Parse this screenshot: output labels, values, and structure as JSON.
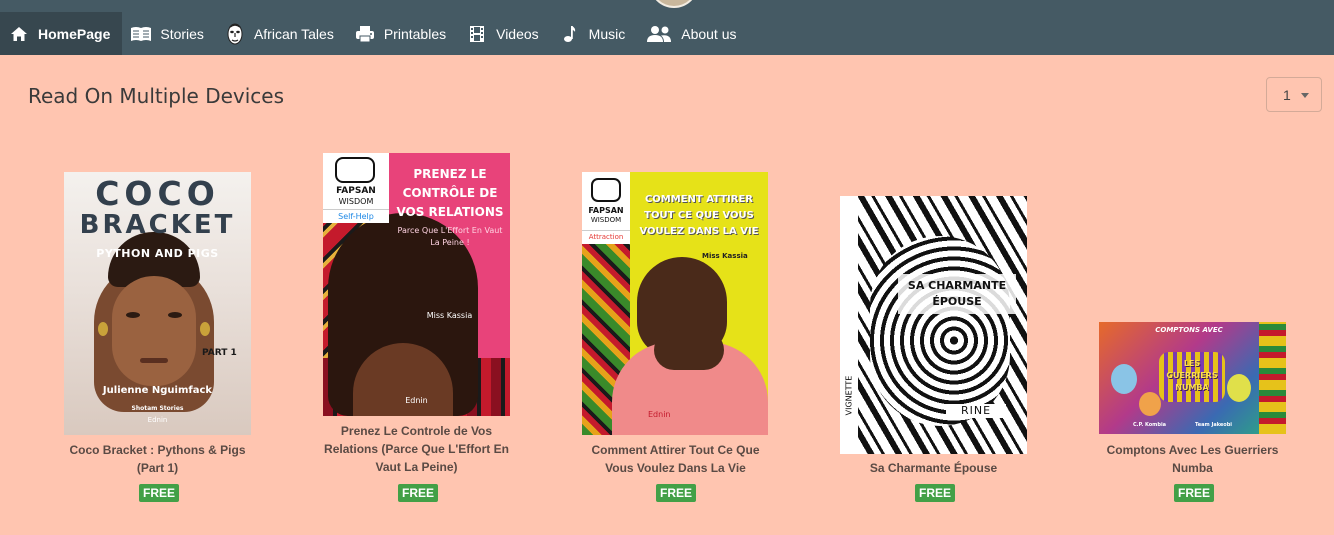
{
  "nav": {
    "items": [
      {
        "label": "HomePage",
        "icon": "home-icon"
      },
      {
        "label": "Stories",
        "icon": "book-icon"
      },
      {
        "label": "African Tales",
        "icon": "mask-icon"
      },
      {
        "label": "Printables",
        "icon": "printer-icon"
      },
      {
        "label": "Videos",
        "icon": "film-icon"
      },
      {
        "label": "Music",
        "icon": "music-note-icon"
      },
      {
        "label": "About us",
        "icon": "users-icon"
      }
    ]
  },
  "section": {
    "title": "Read On Multiple Devices",
    "page_select_value": "1"
  },
  "books": [
    {
      "title": "Coco Bracket : Pythons & Pigs (Part 1)",
      "price": "FREE",
      "cover": {
        "line1": "COCO",
        "line2": "BRACKET",
        "line3": "PYTHON AND PIGS",
        "part": "PART 1",
        "author": "Julienne Nguimfack",
        "publisher": "Shotam Stories",
        "imprint": "Ednin"
      }
    },
    {
      "title": "Prenez Le Controle de Vos Relations (Parce Que L'Effort En Vaut La Peine)",
      "price": "FREE",
      "cover": {
        "brand1": "FAPSAN",
        "brand2": "WISDOM",
        "category": "Self-Help",
        "headline": "PRENEZ LE CONTRÔLE DE VOS RELATIONS",
        "subtitle": "Parce Que L'Effort En Vaut La Peine !",
        "author": "Miss Kassia",
        "imprint": "Ednin"
      }
    },
    {
      "title": "Comment Attirer Tout Ce Que Vous Voulez Dans La Vie",
      "price": "FREE",
      "cover": {
        "brand1": "FAPSAN",
        "brand2": "WISDOM",
        "category": "Attraction",
        "headline": "COMMENT ATTIRER TOUT CE QUE VOUS VOULEZ DANS LA VIE",
        "author": "Miss Kassia",
        "imprint": "Ednin"
      }
    },
    {
      "title": "Sa Charmante Épouse",
      "price": "FREE",
      "cover": {
        "headline": "SA CHARMANTE ÉPOUSE",
        "series": "VIGNETTE",
        "author": "RINE"
      }
    },
    {
      "title": "Comptons Avec Les Guerriers Numba",
      "price": "FREE",
      "cover": {
        "headline1": "COMPTONS AVEC",
        "headline2": "LES GUERRIERS NUMBA",
        "author1": "C.P. Kombia",
        "author2": "Team Jakeobi"
      }
    }
  ],
  "colors": {
    "navbar": "#455a64",
    "navbar_active": "#37474f",
    "page_background": "#ffc5b0",
    "free_badge": "#43a047"
  }
}
